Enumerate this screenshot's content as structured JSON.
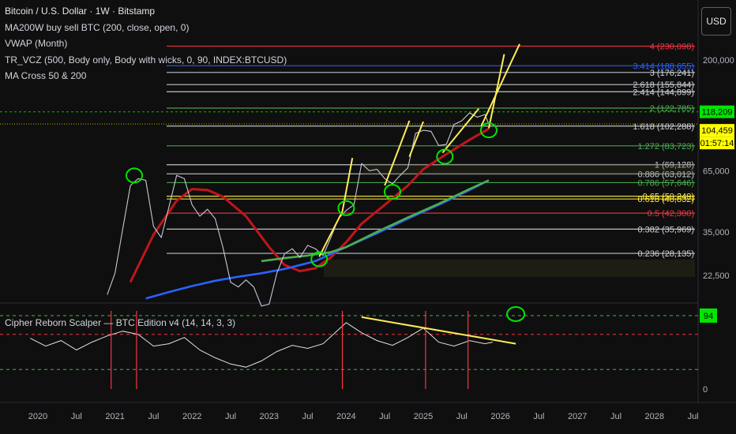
{
  "header": {
    "title": "Bitcoin / U.S. Dollar · 1W · Bitstamp",
    "indicators": [
      "MA200W buy sell BTC (200, close, open, 0)",
      "VWAP (Month)",
      "TR_VCZ (500, Body only, Body with wicks, 0, 90, INDEX:BTCUSD)",
      "MA Cross 50 & 200"
    ],
    "currency_button": "USD"
  },
  "oscillator": {
    "title": "Cipher Reborn Scalper — BTC Edition v4 (14, 14, 3, 3)",
    "current_value_badge": "94",
    "axis_zero": "0"
  },
  "colors": {
    "background": "#0f0f0f",
    "price_candles": "#c8c8d8",
    "ma200_red": "#c0161b",
    "ma_blue": "#2962ff",
    "ma_green": "#4caf50",
    "fib_white": "#d1d4dc",
    "fib_red": "#f23645",
    "fib_green": "#4caf50",
    "fib_yellow": "#ffeb3b",
    "trend_yellow": "#ffee58",
    "annotation_green": "#00e600",
    "price_badge_green": "#00e600",
    "price_badge_yellow": "#ffff00"
  },
  "chart_data": {
    "type": "line",
    "price_axis": {
      "scale": "log",
      "ticks": [
        "200,000",
        "65,000",
        "35,000",
        "22,500"
      ]
    },
    "time_axis": {
      "ticks": [
        "2020",
        "Jul",
        "2021",
        "Jul",
        "2022",
        "Jul",
        "2023",
        "Jul",
        "2024",
        "Jul",
        "2025",
        "Jul",
        "2026",
        "Jul",
        "2027",
        "Jul",
        "2028",
        "Jul"
      ]
    },
    "price_badges": [
      {
        "label": "118,209",
        "style": "green"
      },
      {
        "label": "104,459",
        "style": "yellow"
      },
      {
        "label": "01:57:14",
        "style": "yellow"
      }
    ],
    "fib_levels": [
      {
        "label": "4 (230,098)",
        "value": 230098,
        "color": "red",
        "x_start": 2021.67
      },
      {
        "label": "3.414 (188,655)",
        "value": 188655,
        "color": "blue",
        "x_start": 2021.67
      },
      {
        "label": "3 (176,241)",
        "value": 176241,
        "color": "white",
        "x_start": 2021.67
      },
      {
        "label": "2.618 (155,844)",
        "value": 155844,
        "color": "white",
        "x_start": 2021.67
      },
      {
        "label": "2.414 (144,899)",
        "value": 144899,
        "color": "white",
        "x_start": 2021.67
      },
      {
        "label": "2 (122,785)",
        "value": 122785,
        "color": "green",
        "x_start": 2021.67
      },
      {
        "label": "1.618 (102,288)",
        "value": 102288,
        "color": "white",
        "x_start": 2021.67
      },
      {
        "label": "1.272 (83,723)",
        "value": 83723,
        "color": "green",
        "x_start": 2021.67
      },
      {
        "label": "1 (69,128)",
        "value": 69128,
        "color": "white",
        "x_start": 2021.67
      },
      {
        "label": "0.886 (63,012)",
        "value": 63012,
        "color": "white",
        "x_start": 2021.67
      },
      {
        "label": "0.786 (57,646)",
        "value": 57646,
        "color": "green",
        "x_start": 2021.67
      },
      {
        "label": "0.65 (50,249)",
        "value": 50249,
        "color": "yellow",
        "x_start": 2021.67
      },
      {
        "label": "0.618 (48,832)",
        "value": 48832,
        "color": "yellow",
        "x_start": 2021.67
      },
      {
        "label": "0.5 (42,300)",
        "value": 42300,
        "color": "red",
        "x_start": 2021.67
      },
      {
        "label": "0.382 (35,969)",
        "value": 35969,
        "color": "white",
        "x_start": 2021.67
      },
      {
        "label": "0.236 (28,135)",
        "value": 28135,
        "color": "white",
        "x_start": 2021.67
      }
    ],
    "series": [
      {
        "color": "#c0161b",
        "x": [
          2021.2,
          2021.5,
          2021.8,
          2022.0,
          2022.2,
          2022.4,
          2022.7,
          2023.0,
          2023.2,
          2023.4,
          2023.6,
          2023.8,
          2024.0,
          2024.2,
          2024.5,
          2024.8,
          2025.0,
          2025.3,
          2025.6,
          2025.85
        ],
        "y": [
          21000,
          34000,
          48000,
          54000,
          53500,
          50000,
          41000,
          30000,
          25000,
          23500,
          24200,
          27000,
          31500,
          38000,
          46000,
          56000,
          66000,
          77000,
          89000,
          99500
        ]
      },
      {
        "color": "#2962ff",
        "x": [
          2021.4,
          2021.7,
          2022.0,
          2022.3,
          2022.6,
          2022.9,
          2023.2,
          2023.6,
          2024.0,
          2024.4,
          2024.8,
          2025.2,
          2025.6,
          2025.85
        ],
        "y": [
          17800,
          19000,
          20200,
          21300,
          22200,
          23000,
          24000,
          26000,
          30000,
          34500,
          40000,
          46000,
          53500,
          59000
        ]
      },
      {
        "color": "#4caf50",
        "x": [
          2022.9,
          2023.2,
          2023.5,
          2023.8,
          2024.0,
          2024.4,
          2024.8,
          2025.2,
          2025.6,
          2025.85
        ],
        "y": [
          26000,
          26800,
          27500,
          28500,
          30000,
          35000,
          40500,
          46500,
          54000,
          59000
        ]
      },
      {
        "color": "#c8c8d8",
        "x": [
          2020.9,
          2021.0,
          2021.1,
          2021.2,
          2021.3,
          2021.4,
          2021.5,
          2021.6,
          2021.7,
          2021.8,
          2021.9,
          2022.0,
          2022.1,
          2022.2,
          2022.3,
          2022.4,
          2022.5,
          2022.6,
          2022.7,
          2022.8,
          2022.9,
          2023.0,
          2023.1,
          2023.2,
          2023.3,
          2023.4,
          2023.5,
          2023.6,
          2023.7,
          2023.8,
          2023.9,
          2024.0,
          2024.1,
          2024.2,
          2024.3,
          2024.4,
          2024.5,
          2024.6,
          2024.7,
          2024.8,
          2024.9,
          2025.0,
          2025.1,
          2025.2,
          2025.3,
          2025.4,
          2025.5,
          2025.6,
          2025.7,
          2025.8,
          2025.85
        ],
        "y": [
          18500,
          23000,
          36000,
          56000,
          60000,
          59000,
          37000,
          33000,
          45000,
          62000,
          60000,
          46000,
          41000,
          44000,
          40000,
          30000,
          21000,
          20000,
          21500,
          20000,
          16500,
          16800,
          23000,
          28000,
          29500,
          27000,
          30500,
          29500,
          27500,
          33000,
          40000,
          43500,
          46000,
          70000,
          65000,
          66000,
          60000,
          57000,
          62000,
          67000,
          95000,
          98000,
          97000,
          84000,
          85000,
          104000,
          108000,
          117000,
          112000,
          115000,
          104459
        ]
      }
    ],
    "trend_lines_yellow": [
      {
        "x": [
          2023.65,
          2023.95
        ],
        "y": [
          27200,
          43000
        ]
      },
      {
        "x": [
          2023.95,
          2024.08
        ],
        "y": [
          43000,
          74000
        ]
      },
      {
        "x": [
          2024.5,
          2024.82
        ],
        "y": [
          56000,
          108000
        ]
      },
      {
        "x": [
          2024.82,
          2025.0
        ],
        "y": [
          75000,
          107000
        ]
      },
      {
        "x": [
          2025.25,
          2025.72
        ],
        "y": [
          78000,
          122000
        ]
      },
      {
        "x": [
          2025.75,
          2026.25
        ],
        "y": [
          102000,
          235000
        ]
      },
      {
        "x": [
          2025.85,
          2026.05
        ],
        "y": [
          100000,
          212000
        ]
      }
    ],
    "annotation_circles_green": [
      {
        "x": 2021.25,
        "y": 62000
      },
      {
        "x": 2023.65,
        "y": 26500
      },
      {
        "x": 2024.0,
        "y": 44500
      },
      {
        "x": 2024.6,
        "y": 52500
      },
      {
        "x": 2025.28,
        "y": 75000
      },
      {
        "x": 2025.85,
        "y": 98000
      }
    ],
    "oscillator": {
      "ylim": [
        0,
        100
      ],
      "dashed_levels": {
        "green": [
          94,
          25
        ],
        "red": [
          70
        ]
      },
      "values_x": [
        2019.9,
        2020.1,
        2020.3,
        2020.5,
        2020.7,
        2020.9,
        2021.1,
        2021.3,
        2021.5,
        2021.7,
        2021.9,
        2022.1,
        2022.3,
        2022.5,
        2022.7,
        2022.9,
        2023.1,
        2023.3,
        2023.5,
        2023.7,
        2023.9,
        2024.0,
        2024.2,
        2024.4,
        2024.6,
        2024.8,
        2025.0,
        2025.2,
        2025.4,
        2025.6,
        2025.8,
        2025.9
      ],
      "values_y": [
        65,
        55,
        62,
        50,
        60,
        68,
        74,
        70,
        55,
        58,
        66,
        50,
        40,
        32,
        28,
        36,
        48,
        56,
        52,
        58,
        76,
        85,
        72,
        62,
        56,
        66,
        78,
        60,
        55,
        62,
        58,
        60
      ],
      "red_vertical_markers_x": [
        2020.95,
        2021.28,
        2023.95,
        2025.03,
        2025.58
      ]
    }
  }
}
